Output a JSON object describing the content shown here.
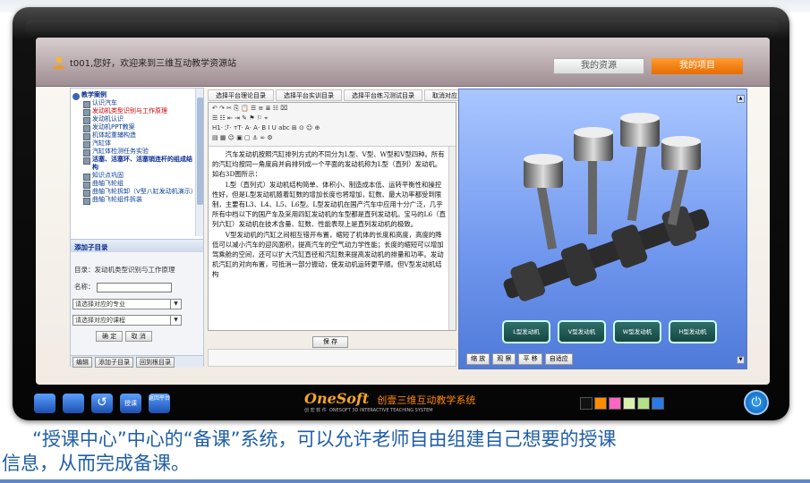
{
  "header": {
    "welcome": "t001,您好，欢迎来到三维互动教学资源站",
    "tabs": [
      "我的资源",
      "我的项目"
    ]
  },
  "tree": {
    "root": "教学案例",
    "items": [
      "认识汽车",
      "发动机类型识别与工作原理",
      "发动机认识",
      "发动机PPT教案",
      "机体起重辅构造",
      "汽缸体",
      "汽缸体检测任务实验"
    ],
    "group2": "活塞、活塞环、活塞销连杆的组成结构",
    "items2": [
      "知识点巩固",
      "曲轴飞轮组",
      "曲轴飞轮拆卸（V型八缸发动机演示）",
      "曲轴飞轮组件拆装"
    ]
  },
  "form": {
    "title": "添加子目录",
    "catalog": "目录：发动机类型识别与工作原理",
    "name_label": "名称：",
    "major_select": "请选择对应的专业",
    "course_select": "请选择对应的课程",
    "confirm": "确 定",
    "cancel": "取 消",
    "bottom_buttons": [
      "编辑",
      "添加子目录",
      "回到根目录"
    ]
  },
  "mid_tabs": [
    "选择平台理论目录",
    "选择平台实训目录",
    "选择平台练习测试目录",
    "取消对应"
  ],
  "toolbar_rows": [
    "↶ ↷ ✂ ⎘ 📋 ☰ ≡ ≣ ☷ ⌧",
    "☰ ☷ ⇤ ⇥ ✎ ⚑ ⚐ ⌖",
    "H1· ℱ· ᴛT· A· A· B I U abc ⊞ ⊙ ☺ ⊕",
    "▤ ▦ ☺ ▣ ▢ ⚓ ∞ ⚙"
  ],
  "editor_paragraphs": [
    "汽车发动机按照汽缸排列方式的不同分为L型、V型、W型和V型四种。所有的汽缸均按同一角度肩并肩排列成一个平面的发动机称为L型（直列）发动机。如右3D图所示：",
    "L型（直列式）发动机结构简单、体积小、制造成本低、运转平衡性和操控性好，但是L型发动机随着缸数的增加长度也将增加，缸数、最大功率都受到限制，主要有L3、L4、L5、L6型。L型发动机在国产汽车中应用十分广泛，几乎所有中档以下的国产车及采用四缸发动机的车型都是直列发动机。宝马的L6（直列六缸）发动机在技术含量、缸数、性能表现上是直列发动机的极致。",
    "V型发动机的汽缸之间相互错开布置，缩短了机体的长度和高度，高度的降低可以减小汽车的迎风面积，提高汽车的空气动力学性能；长度的缩短可以增加驾乘舱的空间，还可以扩大汽缸直径和汽缸数来提高发动机的排量和功率。发动机汽缸的对向布置，可抵消一部分振动，使发动机运转更平顺。但V型发动机结构"
  ],
  "save": "保 存",
  "viewer": {
    "engine_buttons": [
      "L型发动机",
      "V型发动机",
      "W型发动机",
      "H型发动机"
    ],
    "controls": [
      "缩 放",
      "观 察",
      "平 移",
      "自适应"
    ]
  },
  "footer": {
    "logo_main": "OneSoft",
    "logo_cn": "创壹三维互动教学系统",
    "logo_sub_cn": "创 宏 软 件",
    "logo_sub_en": "ONESOFT 3D INTERACTIVE TEACHING SYSTEM",
    "icon_labels": [
      "授课",
      "返回平台"
    ],
    "swatches": [
      "#111111",
      "#ff8c00",
      "#ff66c4",
      "#d9f0b0",
      "#b5e08a",
      "#2a7ae6"
    ]
  },
  "caption": {
    "line1": "“授课中心”中心的“备课”系统，可以允许老师自由组建自己想要的授课",
    "line2": "信息，从而完成备课。"
  }
}
